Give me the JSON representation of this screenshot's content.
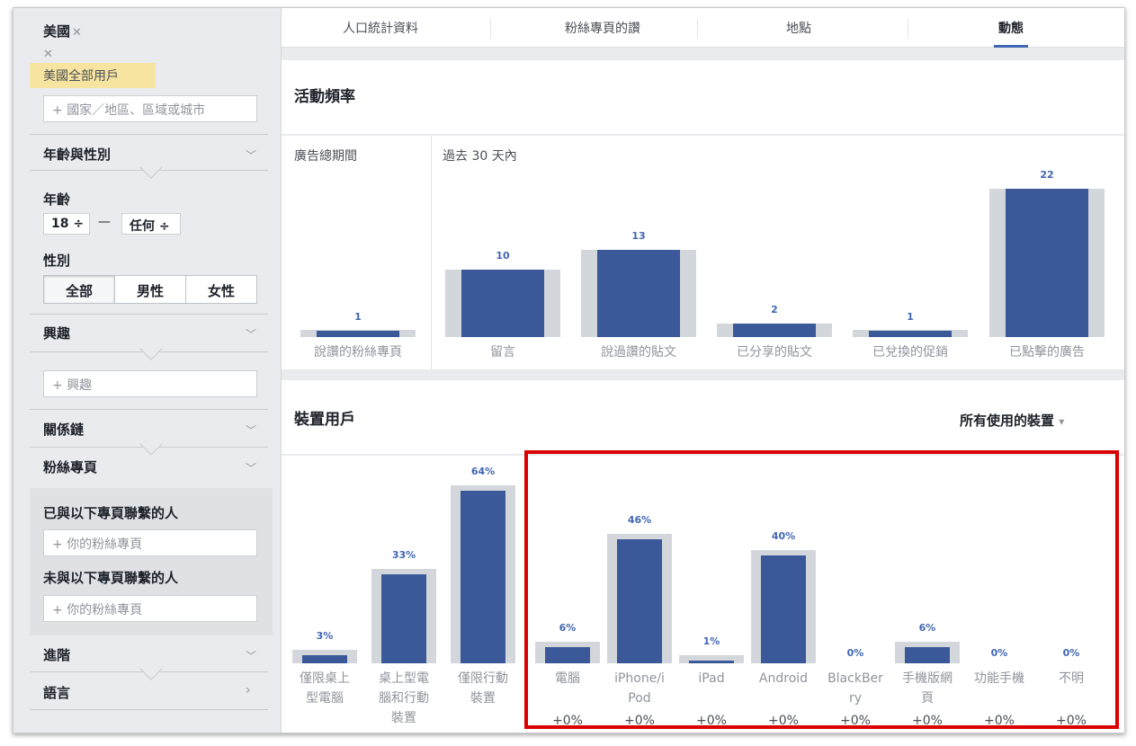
{
  "sidebar": {
    "location_chip": "美國",
    "location_chip_x": "✕",
    "location_x2": "✕",
    "location_highlight": "美國全部用戶",
    "location_placeholder": "國家／地區、區域或城市",
    "age_gender_header": "年齡與性別",
    "age_label": "年齡",
    "age_from": "18 ÷",
    "age_dash": "—",
    "age_to": "任何 ÷",
    "gender_label": "性別",
    "gender_options": [
      "全部",
      "男性",
      "女性"
    ],
    "interests_header": "興趣",
    "interests_placeholder": "興趣",
    "connections_header": "關係鏈",
    "pages_header": "粉絲專頁",
    "connected_label": "已與以下專頁聯繫的人",
    "connected_placeholder": "你的粉絲專頁",
    "not_connected_label": "未與以下專頁聯繫的人",
    "not_connected_placeholder": "你的粉絲專頁",
    "advanced_header": "進階",
    "language_header": "語言"
  },
  "tabs": [
    "人口統計資料",
    "粉絲專頁的讚",
    "地點",
    "動態"
  ],
  "activity": {
    "title": "活動頻率",
    "lifetime_label": "廣告總期間",
    "last30_label": "過去 30 天內"
  },
  "devices": {
    "title": "裝置用戶",
    "dropdown": "所有使用的裝置",
    "dropdown_caret": "▾"
  },
  "colors": {
    "bar": "#3b5998",
    "bar_bg": "#d3d6db",
    "value": "#4267b2",
    "highlight": "#d90000"
  },
  "chart_data": [
    {
      "type": "bar",
      "title": "活動頻率",
      "categories": [
        "說讚的粉絲專頁",
        "留言",
        "說過讚的貼文",
        "已分享的貼文",
        "已兌換的促銷",
        "已點擊的廣告"
      ],
      "values": [
        1,
        10,
        13,
        2,
        1,
        22
      ],
      "groups": [
        "廣告總期間",
        "過去 30 天內"
      ]
    },
    {
      "type": "bar",
      "title": "裝置用戶",
      "categories": [
        "僅限桌上型電腦",
        "桌上型電腦和行動裝置",
        "僅限行動裝置",
        "電腦",
        "iPhone/iPod",
        "iPad",
        "Android",
        "BlackBerry",
        "手機版網頁",
        "功能手機",
        "不明"
      ],
      "values": [
        3,
        33,
        64,
        6,
        46,
        1,
        40,
        0,
        6,
        0,
        0
      ],
      "value_labels": [
        "3%",
        "33%",
        "64%",
        "6%",
        "46%",
        "1%",
        "40%",
        "0%",
        "6%",
        "0%",
        "0%"
      ],
      "deltas": [
        "",
        "",
        "",
        "+0%",
        "+0%",
        "+0%",
        "+0%",
        "+0%",
        "+0%",
        "+0%",
        "+0%"
      ],
      "unit": "%"
    }
  ]
}
